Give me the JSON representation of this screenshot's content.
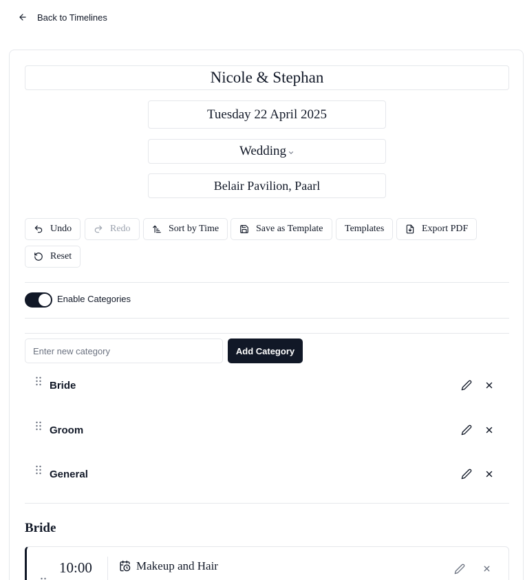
{
  "nav": {
    "back_label": "Back to Timelines"
  },
  "timeline": {
    "title": "Nicole & Stephan",
    "date": "Tuesday 22 April 2025",
    "event_type": "Wedding",
    "venue": "Belair Pavilion, Paarl"
  },
  "toolbar": {
    "undo": "Undo",
    "redo": "Redo",
    "sort": "Sort by Time",
    "save_template": "Save as Template",
    "templates": "Templates",
    "export_pdf": "Export PDF",
    "reset": "Reset"
  },
  "categories": {
    "toggle_label": "Enable Categories",
    "enabled": true,
    "input_placeholder": "Enter new category",
    "input_value": "",
    "add_button": "Add Category",
    "items": [
      {
        "name": "Bride"
      },
      {
        "name": "Groom"
      },
      {
        "name": "General"
      }
    ]
  },
  "sections": [
    {
      "title": "Bride",
      "events": [
        {
          "time": "10:00",
          "title": "Makeup and Hair"
        }
      ]
    }
  ],
  "colors": {
    "primary": "#111827",
    "border": "#e5e7eb",
    "muted": "#9ca3af"
  }
}
